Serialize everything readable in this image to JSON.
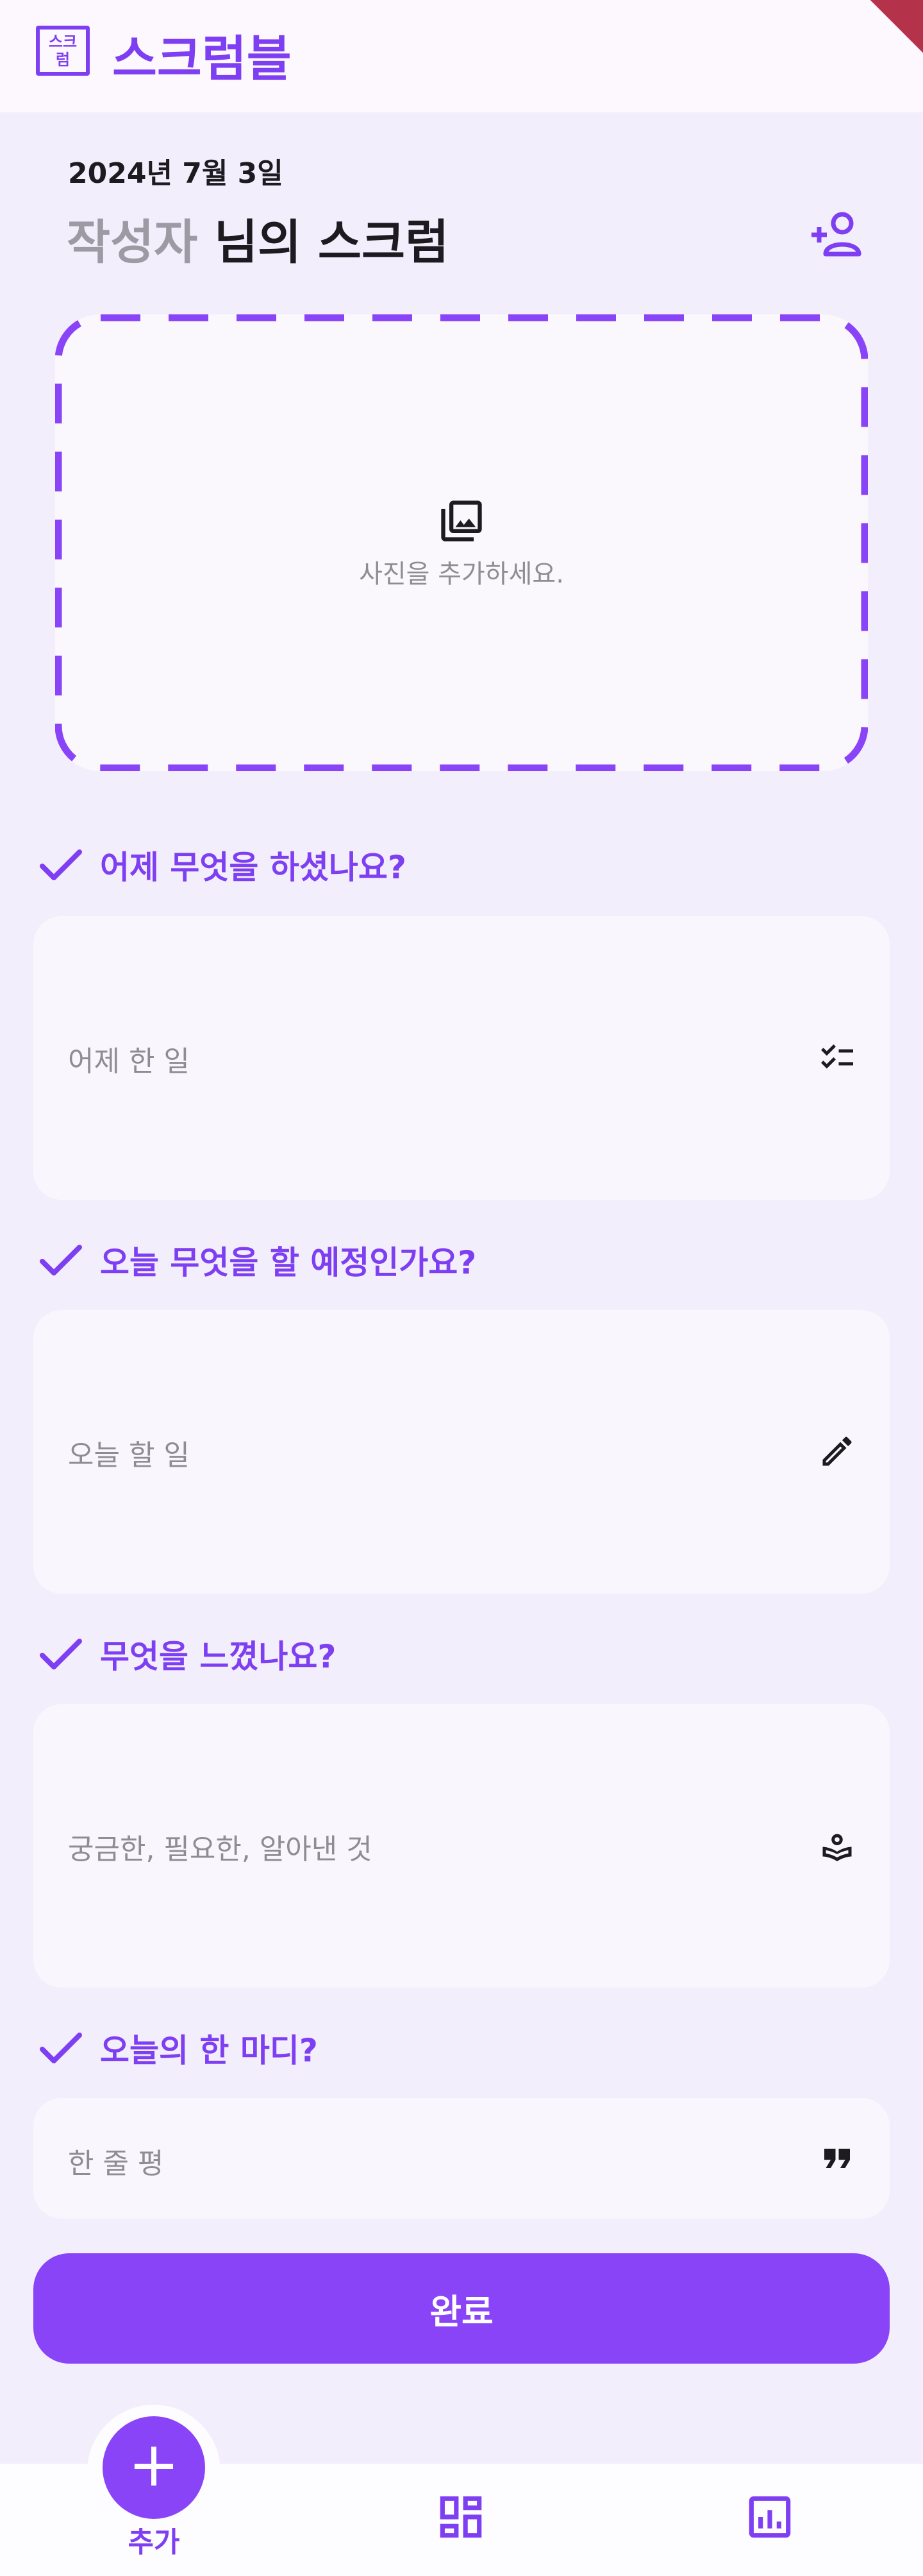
{
  "header": {
    "logo_text": "스크럼",
    "title": "스크럼블"
  },
  "scrum": {
    "date": "2024년 7월 3일",
    "author": "작성자",
    "title_suffix": " 님의 스크럼"
  },
  "photo": {
    "label": "사진을 추가하세요."
  },
  "sections": [
    {
      "question": "어제 무엇을 하셨나요?",
      "placeholder": "어제 한 일",
      "icon": "checklist-icon"
    },
    {
      "question": "오늘 무엇을 할 예정인가요?",
      "placeholder": "오늘 할 일",
      "icon": "pencil-icon"
    },
    {
      "question": "무엇을 느꼈나요?",
      "placeholder": "궁금한, 필요한, 알아낸 것",
      "icon": "book-person-icon"
    },
    {
      "question": "오늘의 한 마디?",
      "placeholder": "한 줄 평",
      "icon": "quote-icon"
    }
  ],
  "submit_label": "완료",
  "nav": {
    "add_label": "추가"
  },
  "colors": {
    "accent": "#7e3ff2",
    "button": "#8a44f7",
    "background": "#f3eefc"
  }
}
